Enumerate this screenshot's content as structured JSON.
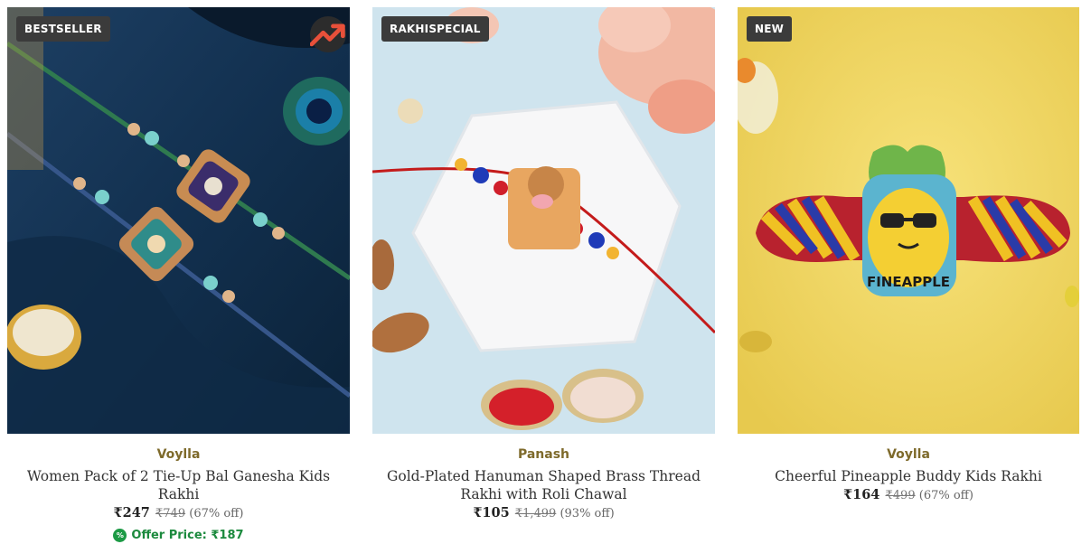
{
  "products": [
    {
      "badge": "BESTSELLER",
      "brand": "Voylla",
      "title": "Women Pack of 2 Tie-Up Bal Ganesha Kids Rakhi",
      "price": "₹247",
      "mrp": "₹749",
      "discount": "(67% off)",
      "offer_price": "Offer Price: ₹187",
      "trend_icon": "trending-up-icon"
    },
    {
      "badge": "RAKHISPECIAL",
      "brand": "Panash",
      "title": "Gold-Plated Hanuman Shaped Brass Thread Rakhi with Roli Chawal",
      "price": "₹105",
      "mrp": "₹1,499",
      "discount": "(93% off)"
    },
    {
      "badge": "NEW",
      "brand": "Voylla",
      "title": "Cheerful Pineapple Buddy Kids Rakhi",
      "price": "₹164",
      "mrp": "₹499",
      "discount": "(67% off)",
      "image_text": "FINEAPPLE"
    }
  ],
  "colors": {
    "brand_text": "#7e6a2b",
    "offer_green": "#1c8a3e",
    "badge_bg": "#3b3b3b",
    "trend_accent": "#e8503a"
  }
}
